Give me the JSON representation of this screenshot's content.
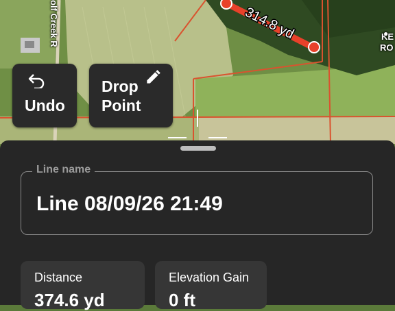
{
  "map": {
    "measure_label": "314.8 yd",
    "road_label": "olf Creek R",
    "place_label_line1": "KE",
    "place_label_line2": "RO"
  },
  "toolbar": {
    "undo_label": "Undo",
    "drop_point_line1": "Drop",
    "drop_point_line2": "Point"
  },
  "form": {
    "line_name_label": "Line name",
    "line_name_value": "Line 08/09/26 21:49"
  },
  "stats": [
    {
      "label": "Distance",
      "value": "374.6 yd"
    },
    {
      "label": "Elevation Gain",
      "value": "0 ft"
    }
  ],
  "colors": {
    "route": "#e8412a",
    "sheet": "#262626"
  }
}
